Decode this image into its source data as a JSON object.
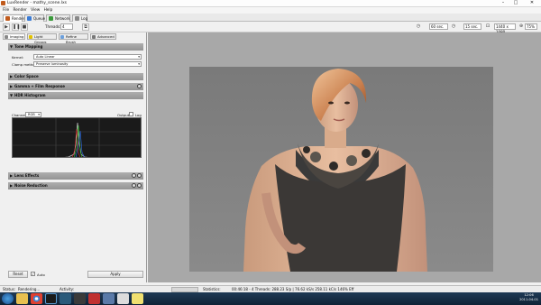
{
  "window": {
    "title": "LuxRender - mathy_scene.lxs",
    "minimize": "–",
    "maximize": "□",
    "close": "✕"
  },
  "menu": [
    "File",
    "Render",
    "View",
    "Help"
  ],
  "main_tabs": [
    {
      "label": "Render",
      "icon": "render-icon",
      "color": "#c05a1c"
    },
    {
      "label": "Queue",
      "icon": "queue-icon",
      "color": "#3a7bd5"
    },
    {
      "label": "Network",
      "icon": "network-icon",
      "color": "#3a9a3a"
    },
    {
      "label": "Log",
      "icon": "log-icon",
      "color": "#888888"
    }
  ],
  "toolbar": {
    "threads_label": "Threads:",
    "threads_value": "4",
    "halt_time": "60 sec.",
    "halt_spp": "15 sec.",
    "resolution": "1440 x 1080",
    "zoom": "75%"
  },
  "sub_tabs": [
    {
      "label": "Imaging",
      "color": "#888888"
    },
    {
      "label": "Light Groups",
      "color": "#e2c200"
    },
    {
      "label": "Refine Brush",
      "color": "#6ca0dc"
    },
    {
      "label": "Advanced",
      "color": "#777777"
    }
  ],
  "tone_mapping": {
    "title": "Tone Mapping",
    "kernel_label": "Kernel:",
    "kernel_value": "Auto Linear",
    "clamp_label": "Clamp method:",
    "clamp_value": "Preserve luminosity"
  },
  "sections": {
    "color_space": "Color Space",
    "gamma": "Gamma + Film Response",
    "hdr": "HDR Histogram",
    "lens": "Lens Effects",
    "noise": "Noise Reduction"
  },
  "histogram": {
    "channel_label": "Channel:",
    "channel_value": "RGB",
    "output_label": "Output",
    "log_label": "Log"
  },
  "bottom": {
    "reset": "Reset",
    "auto": "Auto",
    "apply": "Apply"
  },
  "status": {
    "status_label": "Status:",
    "status_value": "Rendering...",
    "activity_label": "Activity:",
    "statistics_label": "Statistics:",
    "statistics_value": "00:46:18 - 4 Threads: 288.23 S/p | 76.62 kS/s 258.11 kC/s 146% Eff"
  },
  "taskbar": {
    "time": "12:06",
    "date": "2011-04-01",
    "apps": [
      "start-orb",
      "explorer-icon",
      "chrome-icon",
      "terminal-icon",
      "luxrender-icon",
      "editor-icon",
      "app-icon",
      "notes-icon"
    ]
  }
}
